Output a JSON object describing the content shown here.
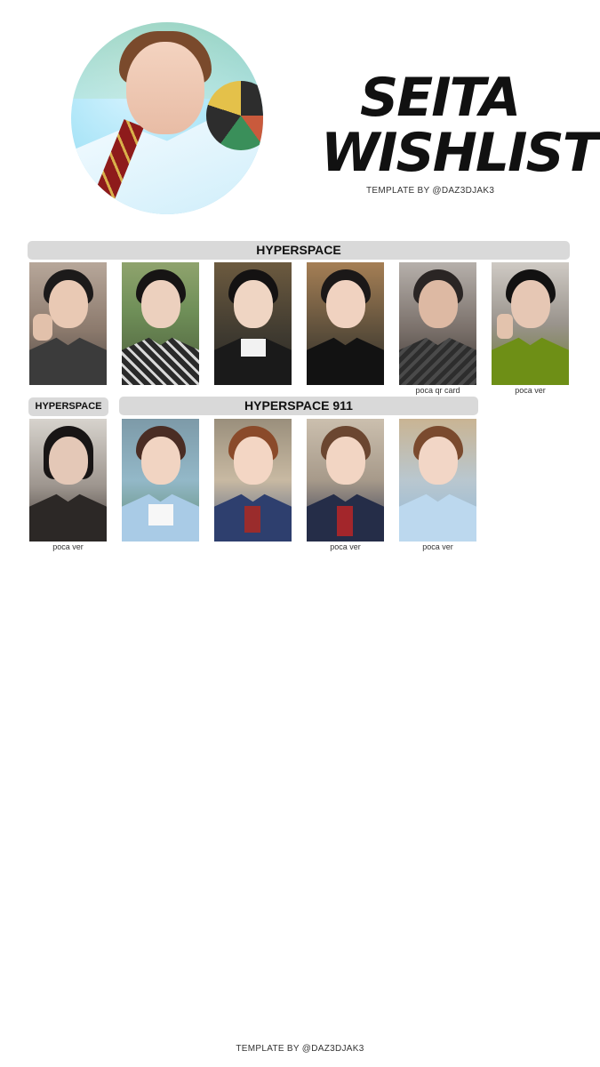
{
  "title": {
    "line1": "SEITA",
    "line2": "WISHLIST"
  },
  "credit": {
    "top": "TEMPLATE BY @DAZ3DJAK3",
    "bottom": "TEMPLATE BY @DAZ3DJAK3"
  },
  "sections": {
    "hyperspace": "HYPERSPACE",
    "hyperspace_small": "HYPERSPACE",
    "hyperspace_911": "HYPERSPACE 911"
  },
  "row1": {
    "captions": [
      "",
      "",
      "",
      "",
      "poca qr card",
      "poca ver"
    ]
  },
  "row2": {
    "captions": [
      "poca ver",
      "",
      "",
      "poca ver",
      "poca ver"
    ]
  },
  "colors": {
    "header_bg": "#d9d9d9",
    "text": "#111111",
    "circle_bg": "#aee6f8"
  }
}
